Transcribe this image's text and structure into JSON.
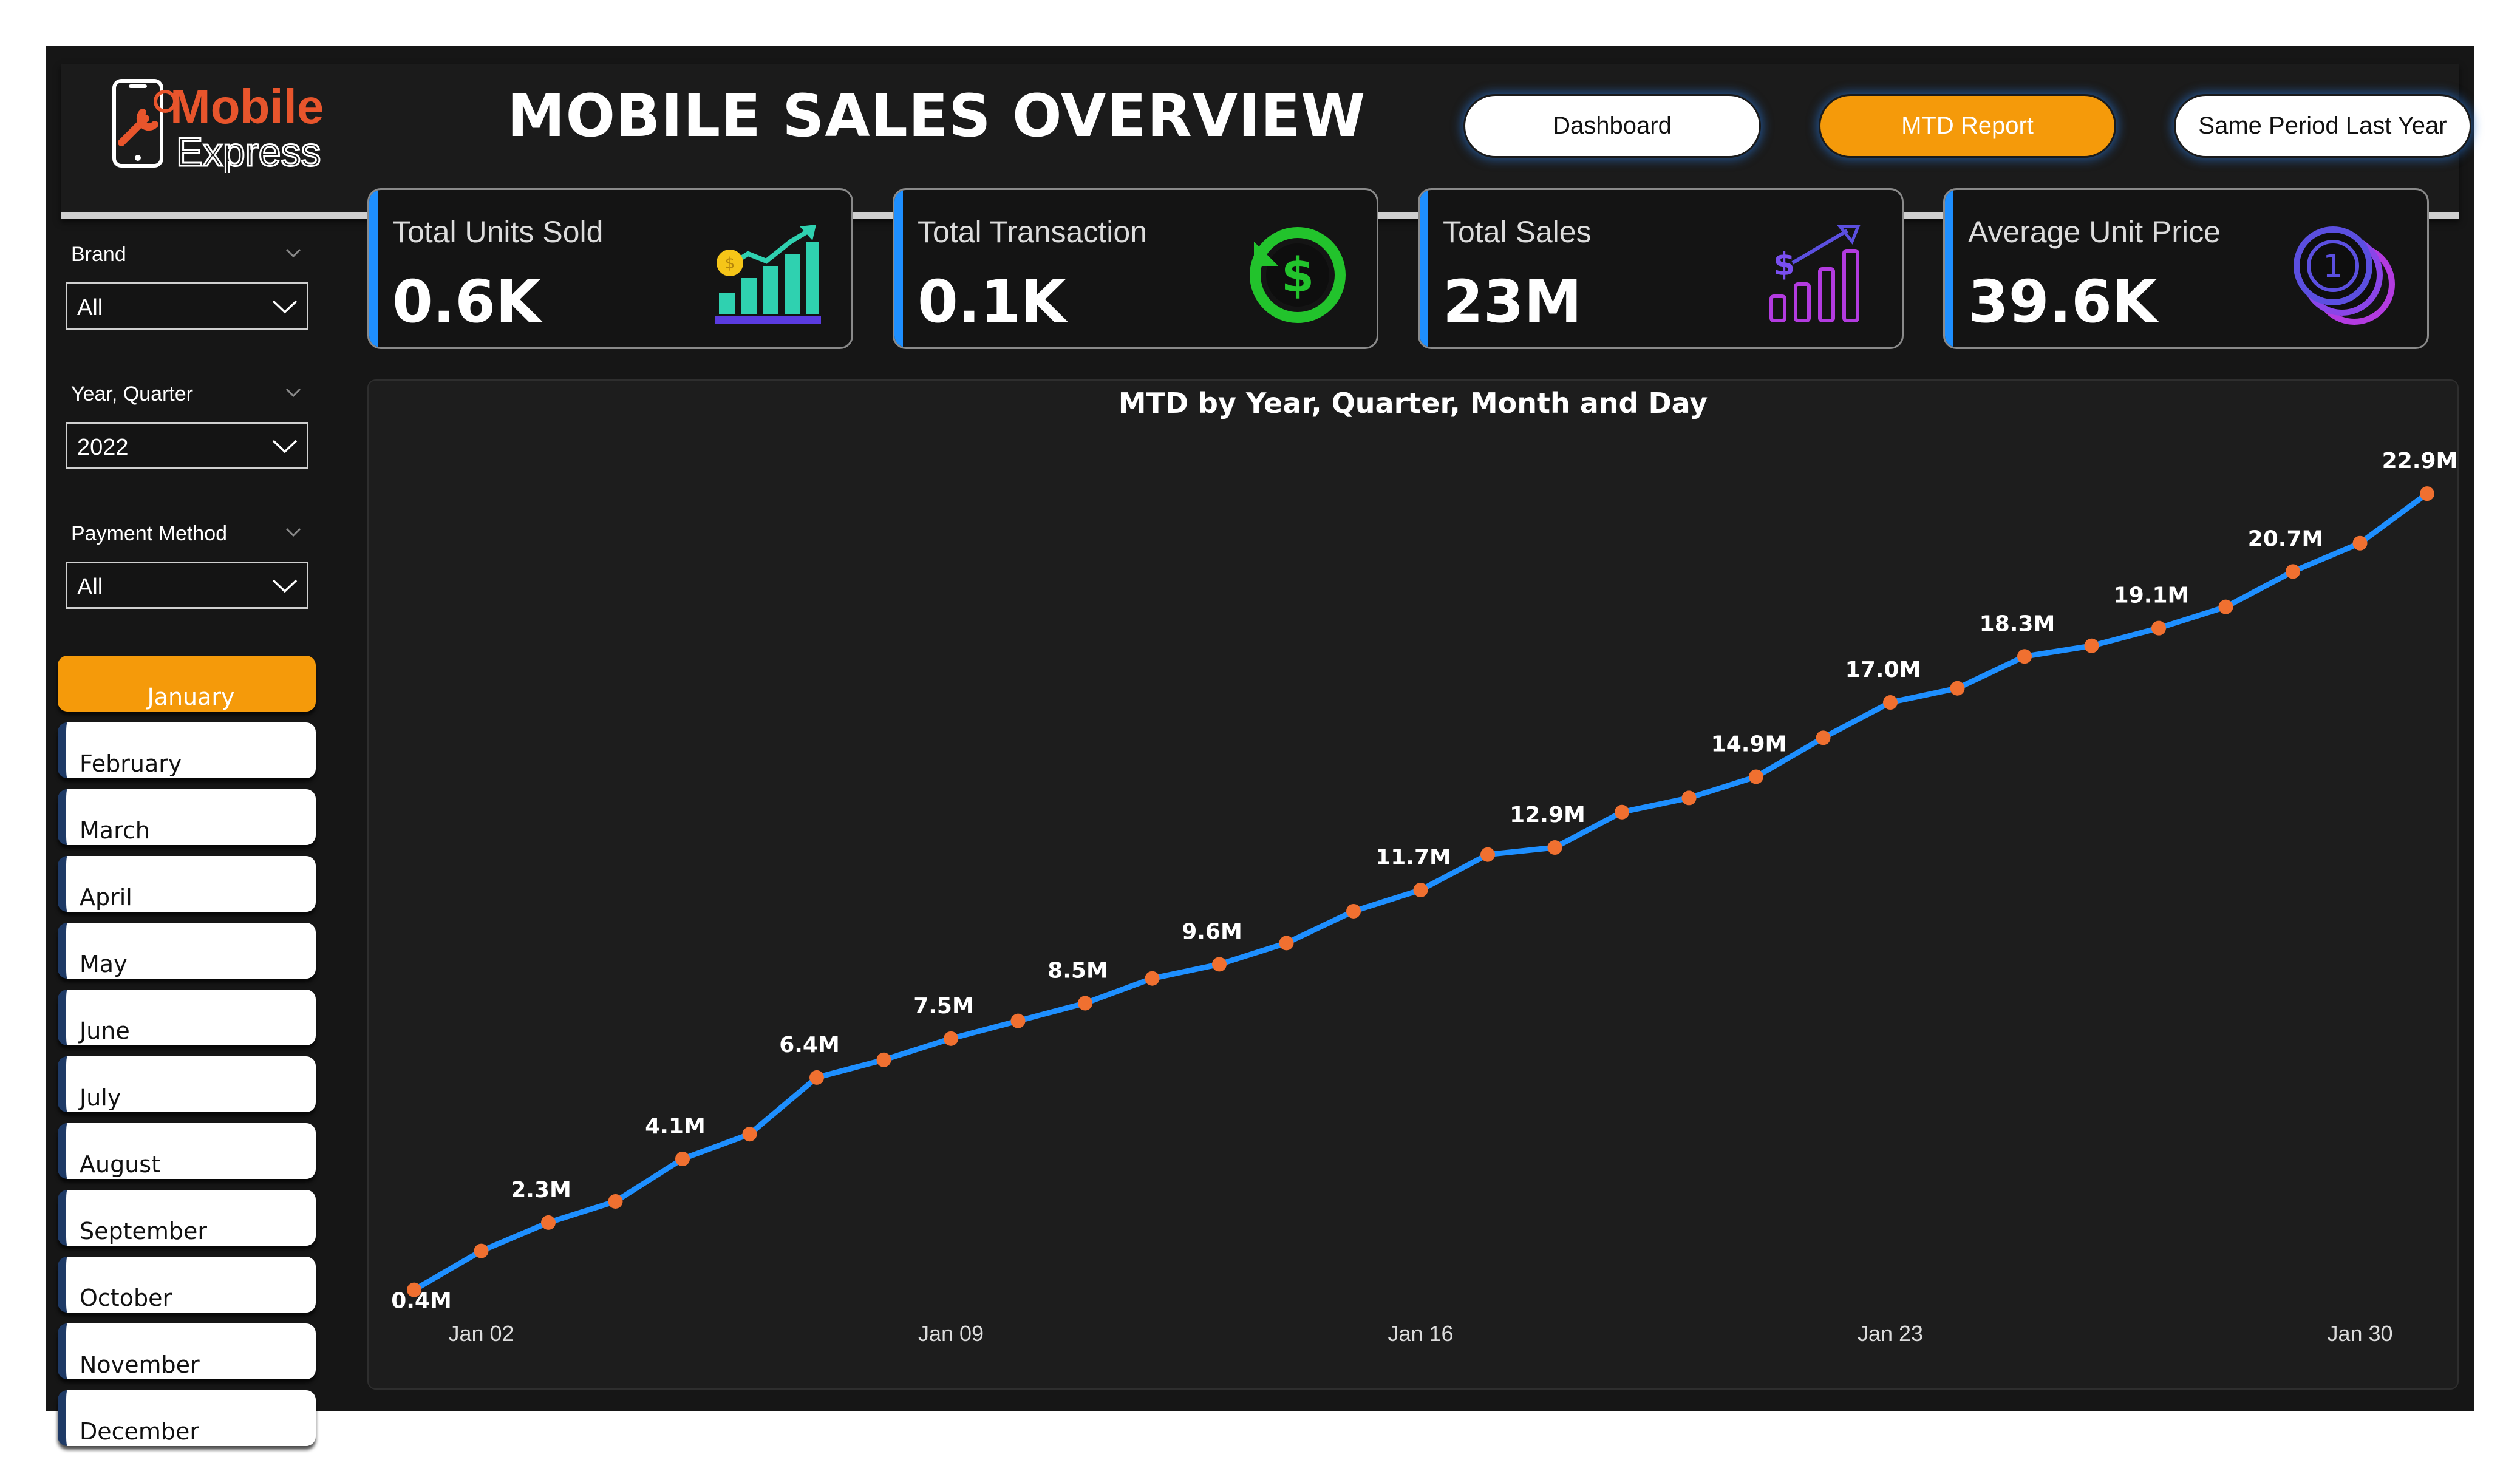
{
  "header": {
    "logo_text_line1": "Mobile",
    "logo_text_line2": "Express",
    "title": "MOBILE SALES OVERVIEW",
    "nav": [
      {
        "label": "Dashboard",
        "active": false
      },
      {
        "label": "MTD Report",
        "active": true
      },
      {
        "label": "Same Period Last Year",
        "active": false
      }
    ]
  },
  "filters": {
    "brand": {
      "label": "Brand",
      "value": "All"
    },
    "year_quarter": {
      "label": "Year, Quarter",
      "value": "2022"
    },
    "payment_method": {
      "label": "Payment Method",
      "value": "All"
    }
  },
  "months": {
    "selected": "January",
    "items": [
      "January",
      "February",
      "March",
      "April",
      "May",
      "June",
      "July",
      "August",
      "September",
      "October",
      "November",
      "December"
    ]
  },
  "kpis": [
    {
      "label": "Total Units Sold",
      "value": "0.6K",
      "icon": "bar-chart-growth-coin-icon"
    },
    {
      "label": "Total Transaction",
      "value": "0.1K",
      "icon": "dollar-refresh-icon"
    },
    {
      "label": "Total Sales",
      "value": "23M",
      "icon": "sales-growth-bars-icon"
    },
    {
      "label": "Average Unit Price",
      "value": "39.6K",
      "icon": "coin-stack-icon"
    }
  ],
  "colors": {
    "accent_orange": "#f59a0a",
    "accent_blue": "#1e8fff",
    "line": "#1e8fff",
    "marker": "#f07030",
    "background": "#161616"
  },
  "chart_data": {
    "type": "line",
    "title": "MTD by Year, Quarter, Month and Day",
    "x_ticks": [
      "Jan 02",
      "Jan 09",
      "Jan 16",
      "Jan 23",
      "Jan 30"
    ],
    "x": [
      1,
      2,
      3,
      4,
      5,
      6,
      7,
      8,
      9,
      10,
      11,
      12,
      13,
      14,
      15,
      16,
      17,
      18,
      19,
      20,
      21,
      22,
      23,
      24,
      25,
      26,
      27,
      28,
      29,
      30,
      31
    ],
    "values": [
      0.4,
      1.5,
      2.3,
      2.9,
      4.1,
      4.8,
      6.4,
      6.9,
      7.5,
      8.0,
      8.5,
      9.2,
      9.6,
      10.2,
      11.1,
      11.7,
      12.7,
      12.9,
      13.9,
      14.3,
      14.9,
      16.0,
      17.0,
      17.4,
      18.3,
      18.6,
      19.1,
      19.7,
      20.7,
      21.5,
      22.9
    ],
    "labels": [
      {
        "day": 1,
        "text": "0.4M"
      },
      {
        "day": 3,
        "text": "2.3M"
      },
      {
        "day": 5,
        "text": "4.1M"
      },
      {
        "day": 7,
        "text": "6.4M"
      },
      {
        "day": 9,
        "text": "7.5M"
      },
      {
        "day": 11,
        "text": "8.5M"
      },
      {
        "day": 13,
        "text": "9.6M"
      },
      {
        "day": 16,
        "text": "11.7M"
      },
      {
        "day": 18,
        "text": "12.9M"
      },
      {
        "day": 21,
        "text": "14.9M"
      },
      {
        "day": 23,
        "text": "17.0M"
      },
      {
        "day": 25,
        "text": "18.3M"
      },
      {
        "day": 27,
        "text": "19.1M"
      },
      {
        "day": 29,
        "text": "20.7M"
      },
      {
        "day": 31,
        "text": "22.9M"
      }
    ],
    "ylim": [
      0,
      24
    ],
    "grid": false,
    "legend": "none"
  }
}
